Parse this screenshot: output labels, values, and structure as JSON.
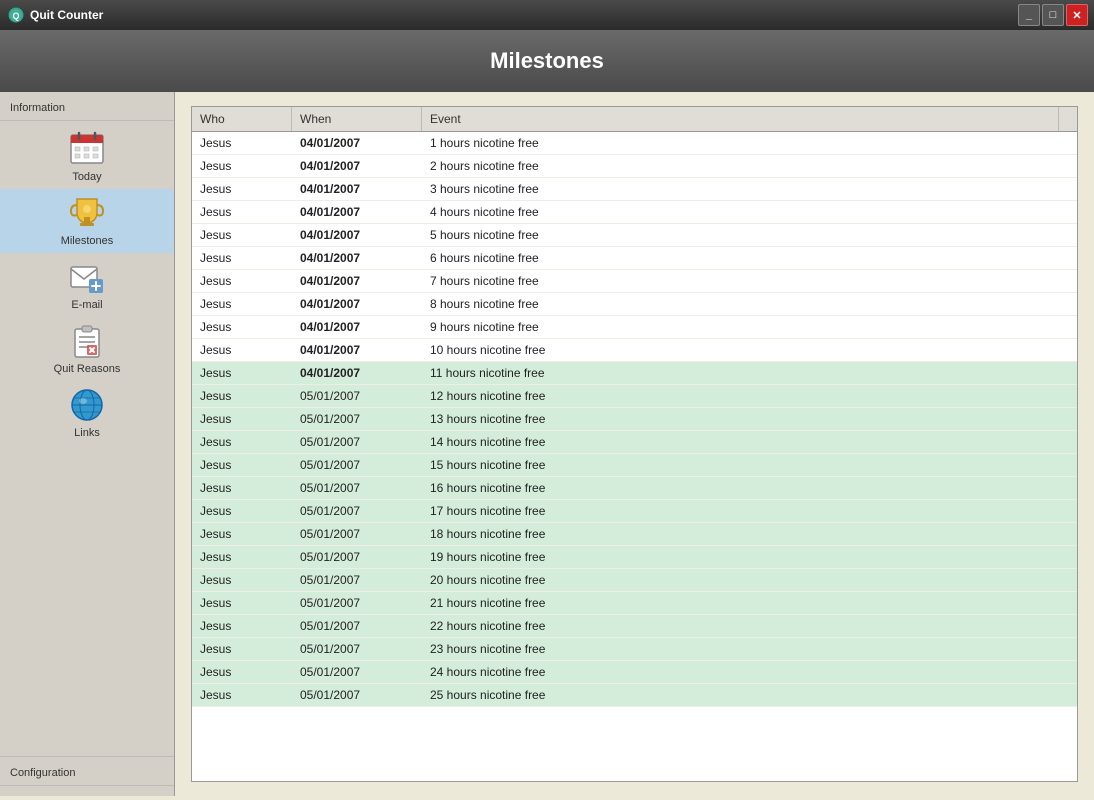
{
  "window": {
    "title": "Quit Counter",
    "controls": {
      "minimize": "_",
      "maximize": "□",
      "close": "✕"
    }
  },
  "header": {
    "title": "Milestones"
  },
  "sidebar": {
    "info_section": "Information",
    "items": [
      {
        "id": "today",
        "label": "Today"
      },
      {
        "id": "milestones",
        "label": "Milestones",
        "active": true
      },
      {
        "id": "email",
        "label": "E-mail"
      },
      {
        "id": "quit-reasons",
        "label": "Quit Reasons"
      },
      {
        "id": "links",
        "label": "Links"
      }
    ],
    "config_section": "Configuration"
  },
  "table": {
    "columns": [
      "Who",
      "When",
      "Event"
    ],
    "rows": [
      {
        "who": "Jesus",
        "when": "04/01/2007",
        "event": "1 hours nicotine free",
        "bold": true,
        "highlighted": false
      },
      {
        "who": "Jesus",
        "when": "04/01/2007",
        "event": "2 hours nicotine free",
        "bold": true,
        "highlighted": false
      },
      {
        "who": "Jesus",
        "when": "04/01/2007",
        "event": "3 hours nicotine free",
        "bold": true,
        "highlighted": false
      },
      {
        "who": "Jesus",
        "when": "04/01/2007",
        "event": "4 hours nicotine free",
        "bold": true,
        "highlighted": false
      },
      {
        "who": "Jesus",
        "when": "04/01/2007",
        "event": "5 hours nicotine free",
        "bold": true,
        "highlighted": false
      },
      {
        "who": "Jesus",
        "when": "04/01/2007",
        "event": "6 hours nicotine free",
        "bold": true,
        "highlighted": false
      },
      {
        "who": "Jesus",
        "when": "04/01/2007",
        "event": "7 hours nicotine free",
        "bold": true,
        "highlighted": false
      },
      {
        "who": "Jesus",
        "when": "04/01/2007",
        "event": "8 hours nicotine free",
        "bold": true,
        "highlighted": false
      },
      {
        "who": "Jesus",
        "when": "04/01/2007",
        "event": "9 hours nicotine free",
        "bold": true,
        "highlighted": false
      },
      {
        "who": "Jesus",
        "when": "04/01/2007",
        "event": "10 hours nicotine free",
        "bold": true,
        "highlighted": false
      },
      {
        "who": "Jesus",
        "when": "04/01/2007",
        "event": "11 hours nicotine free",
        "bold": true,
        "highlighted": true
      },
      {
        "who": "Jesus",
        "when": "05/01/2007",
        "event": "12 hours nicotine free",
        "bold": false,
        "highlighted": true
      },
      {
        "who": "Jesus",
        "when": "05/01/2007",
        "event": "13 hours nicotine free",
        "bold": false,
        "highlighted": true
      },
      {
        "who": "Jesus",
        "when": "05/01/2007",
        "event": "14 hours nicotine free",
        "bold": false,
        "highlighted": true
      },
      {
        "who": "Jesus",
        "when": "05/01/2007",
        "event": "15 hours nicotine free",
        "bold": false,
        "highlighted": true
      },
      {
        "who": "Jesus",
        "when": "05/01/2007",
        "event": "16 hours nicotine free",
        "bold": false,
        "highlighted": true
      },
      {
        "who": "Jesus",
        "when": "05/01/2007",
        "event": "17 hours nicotine free",
        "bold": false,
        "highlighted": true
      },
      {
        "who": "Jesus",
        "when": "05/01/2007",
        "event": "18 hours nicotine free",
        "bold": false,
        "highlighted": true
      },
      {
        "who": "Jesus",
        "when": "05/01/2007",
        "event": "19 hours nicotine free",
        "bold": false,
        "highlighted": true
      },
      {
        "who": "Jesus",
        "when": "05/01/2007",
        "event": "20 hours nicotine free",
        "bold": false,
        "highlighted": true
      },
      {
        "who": "Jesus",
        "when": "05/01/2007",
        "event": "21 hours nicotine free",
        "bold": false,
        "highlighted": true
      },
      {
        "who": "Jesus",
        "when": "05/01/2007",
        "event": "22 hours nicotine free",
        "bold": false,
        "highlighted": true
      },
      {
        "who": "Jesus",
        "when": "05/01/2007",
        "event": "23 hours nicotine free",
        "bold": false,
        "highlighted": true
      },
      {
        "who": "Jesus",
        "when": "05/01/2007",
        "event": "24 hours nicotine free",
        "bold": false,
        "highlighted": true
      },
      {
        "who": "Jesus",
        "when": "05/01/2007",
        "event": "25 hours nicotine free",
        "bold": false,
        "highlighted": true
      }
    ]
  }
}
